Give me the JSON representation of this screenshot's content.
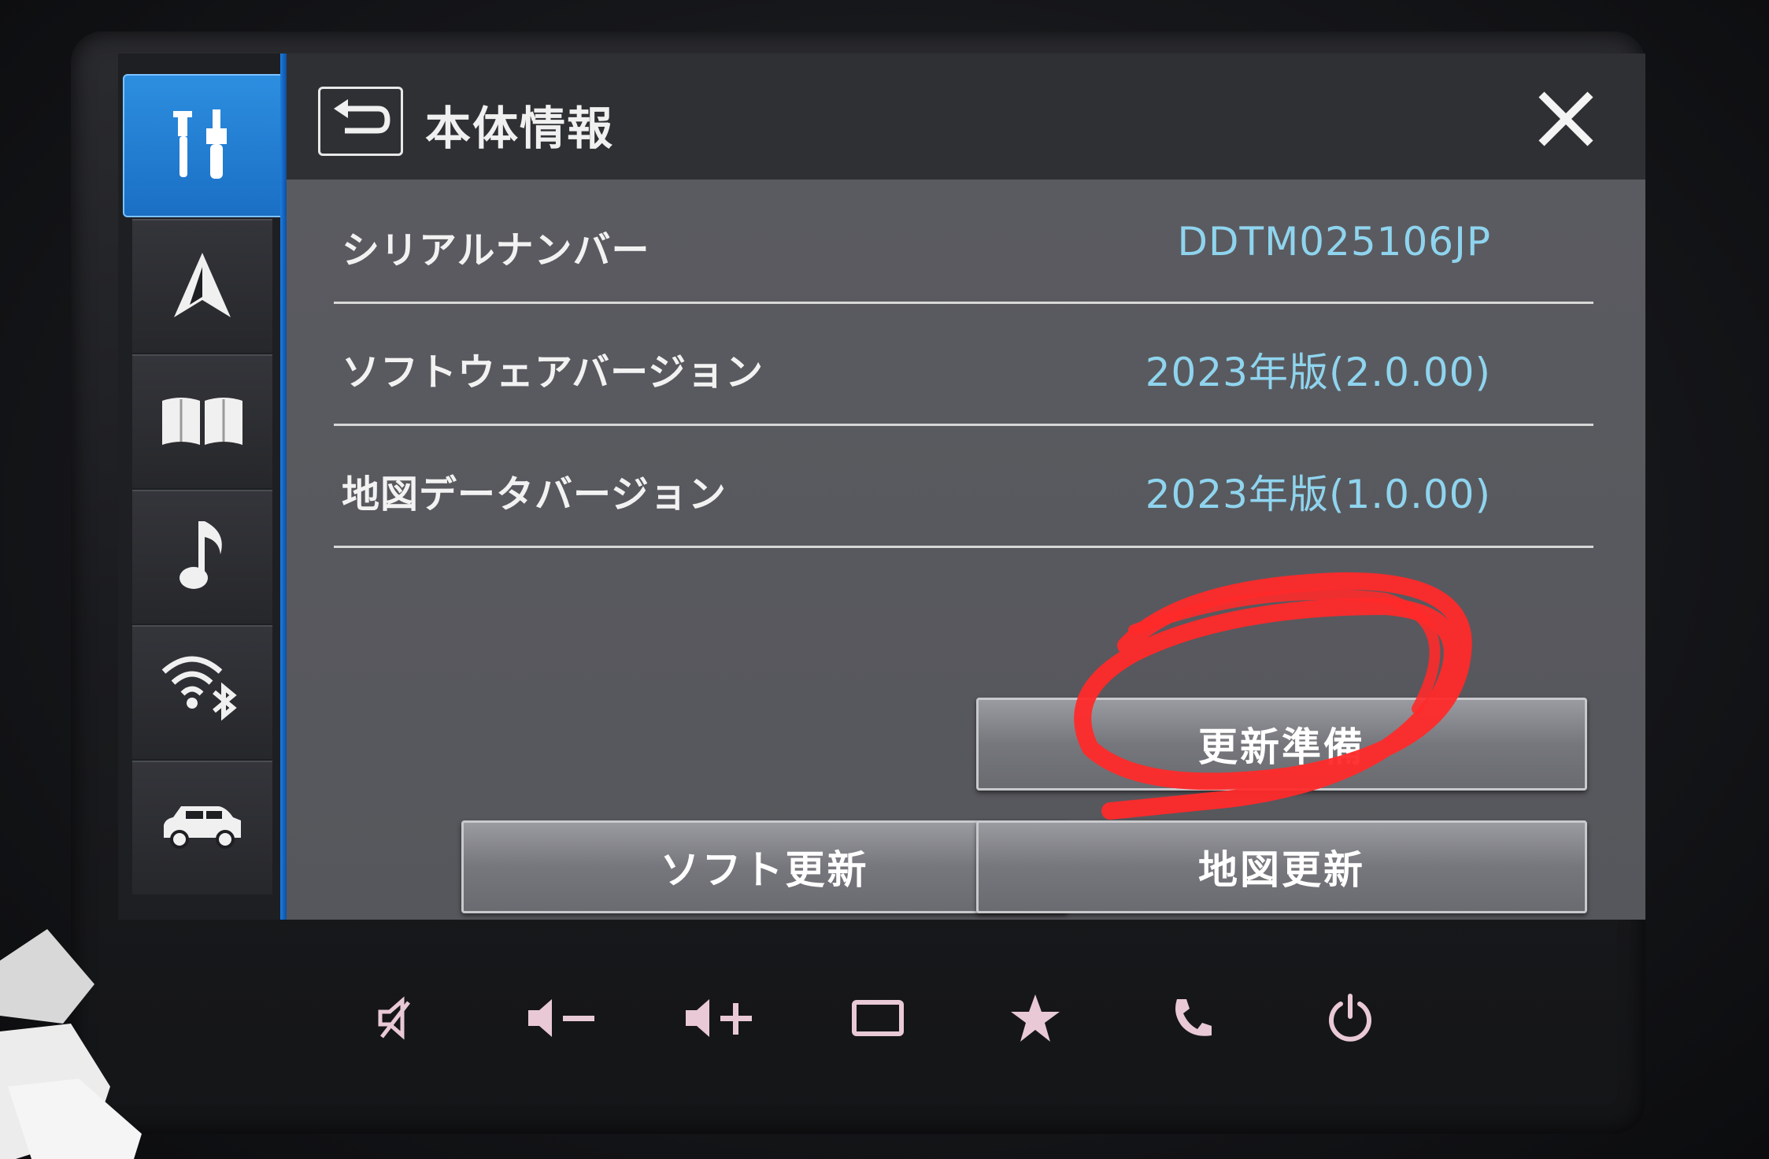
{
  "header": {
    "title": "本体情報",
    "back_icon": "back-arrow-icon",
    "close_icon": "close-icon"
  },
  "nav": {
    "items": [
      {
        "name": "settings",
        "icon": "tools-icon",
        "active": true
      },
      {
        "name": "navigation",
        "icon": "navigation-arrow-icon",
        "active": false
      },
      {
        "name": "map",
        "icon": "map-book-icon",
        "active": false
      },
      {
        "name": "audio",
        "icon": "music-note-icon",
        "active": false
      },
      {
        "name": "connectivity",
        "icon": "wifi-bluetooth-icon",
        "active": false
      },
      {
        "name": "vehicle",
        "icon": "car-icon",
        "active": false
      }
    ]
  },
  "info": {
    "rows": [
      {
        "label": "シリアルナンバー",
        "value": "DDTM025106JP"
      },
      {
        "label": "ソフトウェアバージョン",
        "value": "2023年版(2.0.00)"
      },
      {
        "label": "地図データバージョン",
        "value": "2023年版(1.0.00)"
      }
    ]
  },
  "buttons": {
    "update_prep": "更新準備",
    "soft_update": "ソフト更新",
    "map_update": "地図更新"
  },
  "hardware_buttons": [
    {
      "name": "mute",
      "icon": "mute-icon"
    },
    {
      "name": "volume-down",
      "icon": "volume-down-icon"
    },
    {
      "name": "volume-up",
      "icon": "volume-up-icon"
    },
    {
      "name": "screen",
      "icon": "screen-icon"
    },
    {
      "name": "favorite",
      "icon": "star-icon"
    },
    {
      "name": "phone",
      "icon": "phone-icon"
    },
    {
      "name": "power",
      "icon": "power-icon"
    }
  ],
  "colors": {
    "accent_blue": "#1a6fc4",
    "value_text": "#8fd4ee",
    "annotation_red": "#ff2a2a",
    "hardware_icon": "#e9c9d6"
  }
}
